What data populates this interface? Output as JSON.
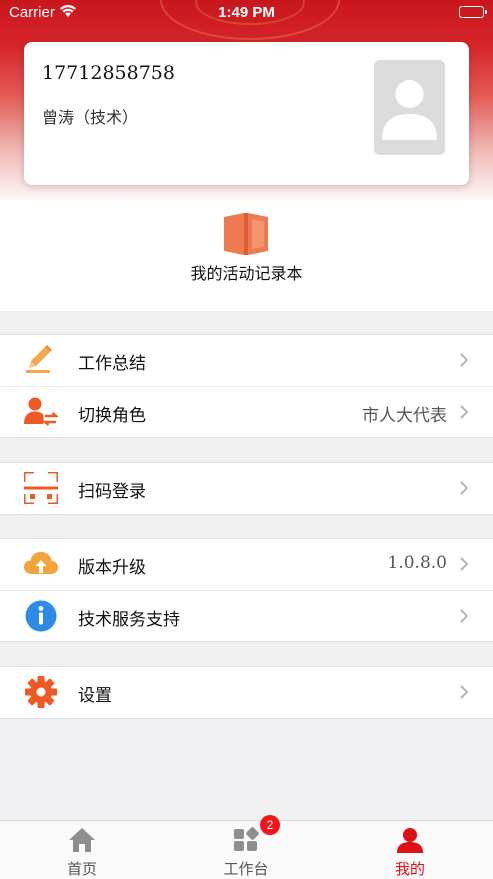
{
  "status_bar": {
    "carrier": "Carrier",
    "time": "1:49 PM"
  },
  "profile": {
    "phone": "17712858758",
    "name": "曾涛（技术）"
  },
  "activity": {
    "label": "我的活动记录本"
  },
  "menu_groups": [
    [
      {
        "title": "工作总结",
        "value": "",
        "icon": "pencil-icon"
      },
      {
        "title": "切换角色",
        "value": "市人大代表",
        "icon": "switch-user-icon"
      }
    ],
    [
      {
        "title": "扫码登录",
        "value": "",
        "icon": "scan-qr-icon"
      }
    ],
    [
      {
        "title": "版本升级",
        "value": "1.0.8.0",
        "icon": "cloud-upload-icon"
      },
      {
        "title": "技术服务支持",
        "value": "",
        "icon": "info-icon"
      }
    ],
    [
      {
        "title": "设置",
        "value": "",
        "icon": "gear-icon"
      }
    ]
  ],
  "tabbar": {
    "items": [
      {
        "label": "首页",
        "icon": "home-icon",
        "active": false
      },
      {
        "label": "工作台",
        "icon": "workbench-icon",
        "active": false,
        "badge": "2"
      },
      {
        "label": "我的",
        "icon": "profile-icon",
        "active": true
      }
    ]
  },
  "colors": {
    "brand_red": "#d6252a",
    "active_tab": "#e00f17",
    "badge": "#f5141c",
    "icon_orange": "#f07a3a"
  }
}
